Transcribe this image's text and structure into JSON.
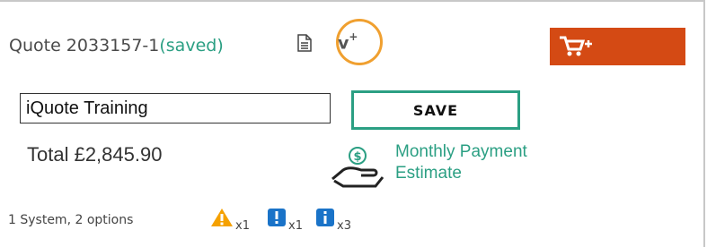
{
  "quote": {
    "label": "Quote 2033157-1",
    "status": "(saved)",
    "version_label": "v",
    "version_sup": "+"
  },
  "name_field": {
    "value": "iQuote Training"
  },
  "save_label": "SAVE",
  "total": "Total £2,845.90",
  "payment": {
    "line1": "Monthly Payment",
    "line2": "Estimate"
  },
  "summary": "1 System, 2 options",
  "alerts": [
    {
      "icon": "warning-icon",
      "count": "x1",
      "color": "#f5a100"
    },
    {
      "icon": "error-icon",
      "count": "x1",
      "color": "#1a73c8"
    },
    {
      "icon": "info-icon",
      "count": "x3",
      "color": "#1a73c8"
    }
  ],
  "colors": {
    "accent": "#2b9f83",
    "cart": "#d44a14",
    "highlight": "#f0a030"
  }
}
